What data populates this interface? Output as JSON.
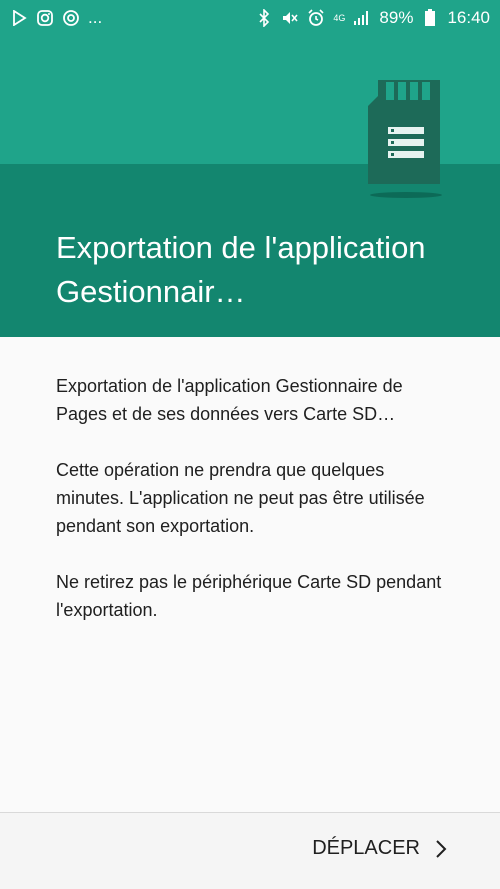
{
  "status_bar": {
    "dots": "...",
    "network": "4G",
    "battery_percent": "89%",
    "time": "16:40",
    "left_icons": [
      "play-store-icon",
      "instagram-icon",
      "sync-icon"
    ],
    "right_icons": [
      "bluetooth-icon",
      "mute-icon",
      "alarm-icon",
      "signal-icon",
      "battery-icon"
    ]
  },
  "colors": {
    "header_dark": "#13866f",
    "header_light": "#1fa48a",
    "sd_card": "#1d6a58"
  },
  "header": {
    "title": "Exportation de l'application Gestionnair…"
  },
  "body": {
    "paragraphs": [
      "Exportation de l'application Gestionnaire de Pages et de ses données vers Carte SD…",
      "Cette opération ne prendra que quelques minutes. L'application ne peut pas être utilisée pendant son exportation.",
      "Ne retirez pas le périphérique Carte SD pendant l'exportation."
    ]
  },
  "footer": {
    "move_label": "DÉPLACER"
  }
}
